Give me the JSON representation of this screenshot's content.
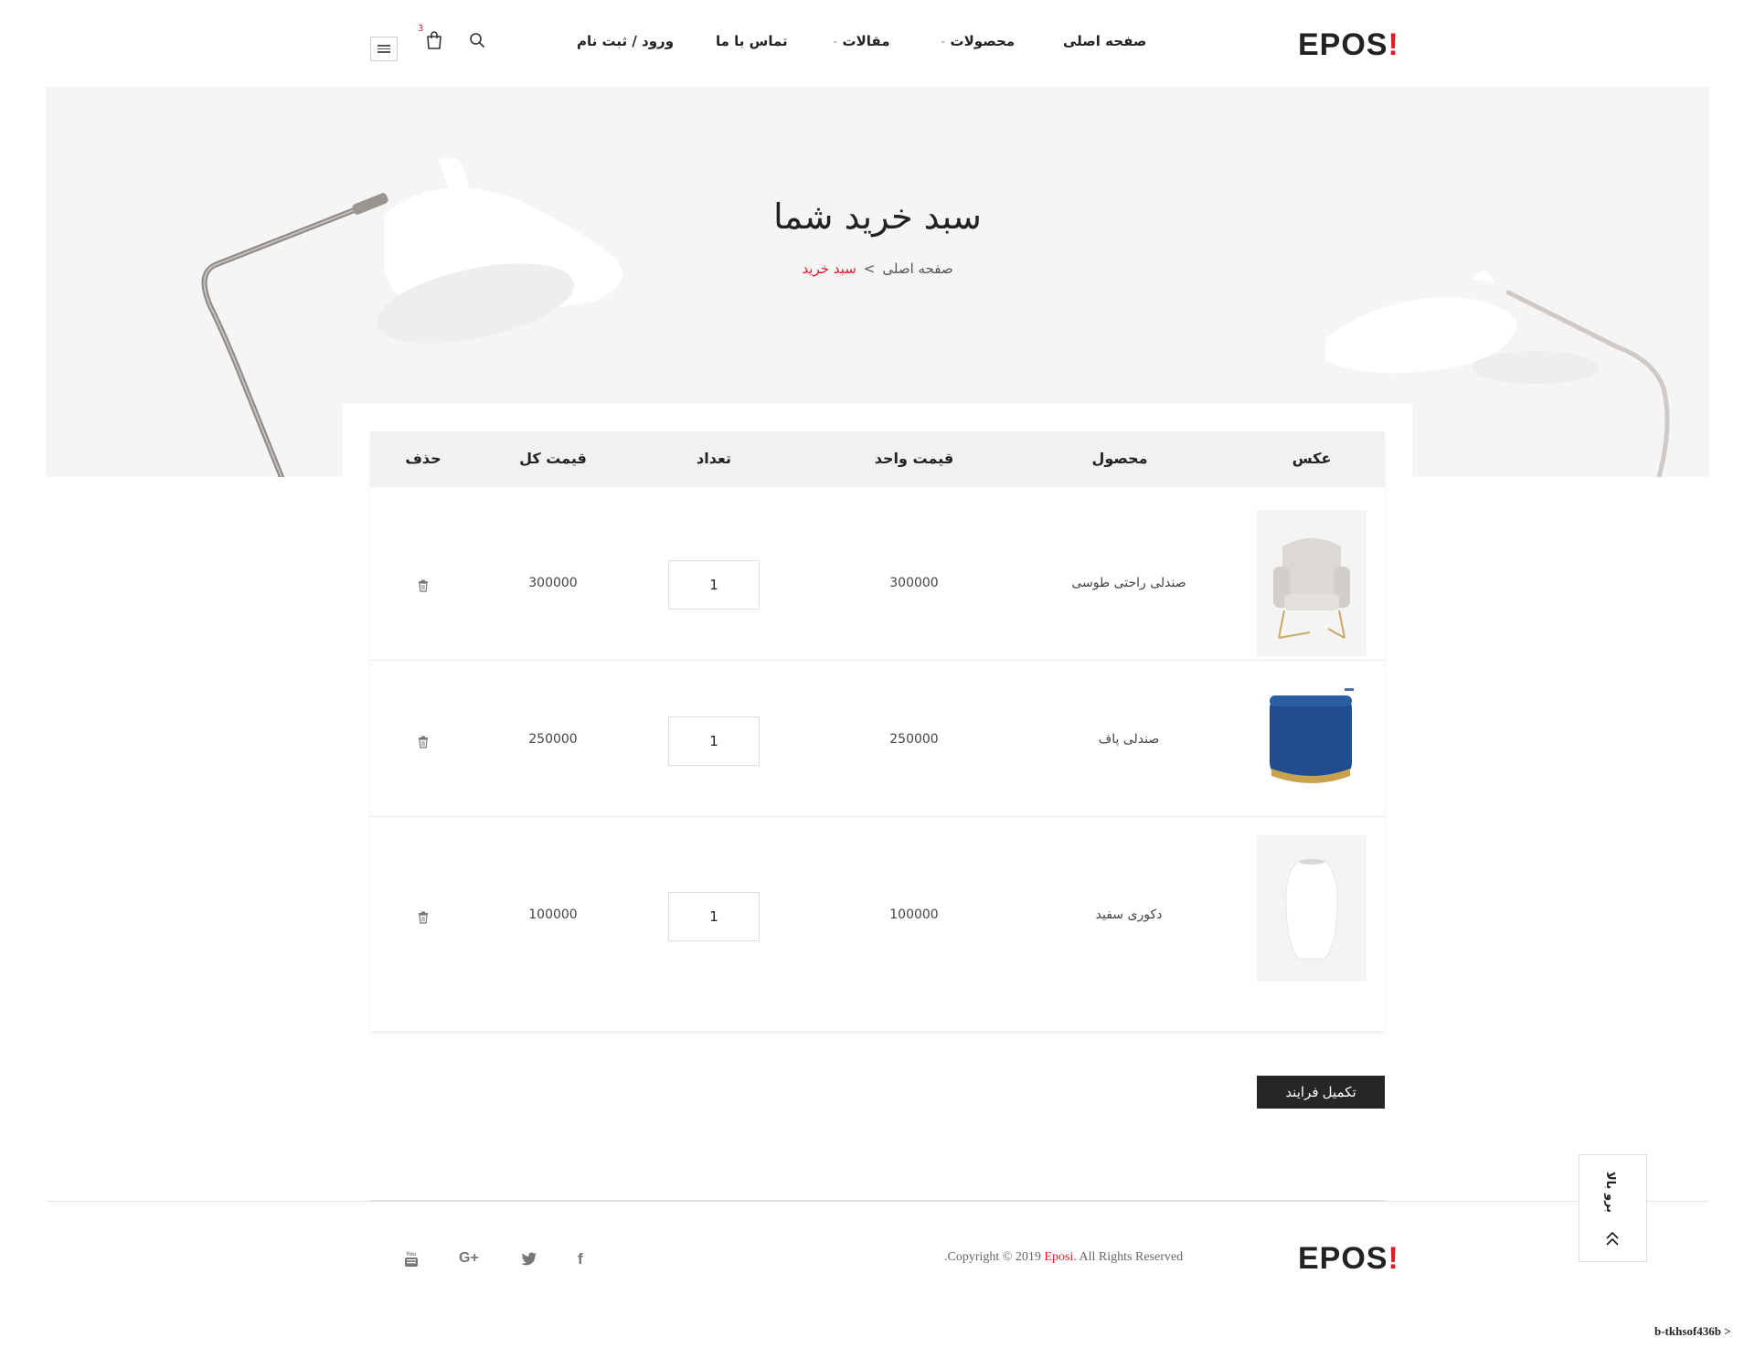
{
  "header": {
    "logo_text": "EPOS",
    "logo_mark": "!",
    "nav": {
      "home": "صفحه اصلی",
      "products": "محصولات",
      "articles": "مقالات",
      "contact": "تماس با ما",
      "login": "ورود / ثبت نام"
    },
    "cart_count": "3",
    "icons": [
      "search-icon",
      "cart-icon",
      "menu-icon",
      "chevron-down-icon"
    ]
  },
  "banner": {
    "title": "سبد خرید شما",
    "breadcrumb": {
      "home": "صفحه اصلی",
      "separator": ">",
      "current": "سبد خرید"
    }
  },
  "cart": {
    "headers": {
      "image": "عکس",
      "product": "محصول",
      "unit_price": "قیمت واحد",
      "quantity": "تعداد",
      "total": "قیمت کل",
      "remove": "حذف"
    },
    "items": [
      {
        "name": "صندلی راحتی طوسی",
        "unit_price": "300000",
        "quantity": "1",
        "total": "300000",
        "image": "armchair-image"
      },
      {
        "name": "صندلی پاف",
        "unit_price": "250000",
        "quantity": "1",
        "total": "250000",
        "image": "pouf-image"
      },
      {
        "name": "دکوری سفید",
        "unit_price": "100000",
        "quantity": "1",
        "total": "100000",
        "image": "vase-image"
      }
    ],
    "checkout_label": "تکمیل فرایند"
  },
  "footer": {
    "logo_text": "EPOS",
    "logo_mark": "!",
    "copyright_prefix": ".Copyright © 2019 ",
    "copyright_brand": "Eposi",
    "copyright_suffix": ". All Rights Reserved",
    "social": [
      "facebook-icon",
      "twitter-icon",
      "google-plus-icon",
      "youtube-icon"
    ],
    "back_to_top": "برو بالا"
  },
  "corner_text": "b-tkhsof436b >",
  "colors": {
    "accent": "#e01c2a",
    "dark_button": "#262626",
    "banner_bg": "#f5f5f5",
    "table_header_bg": "#f1f1f1"
  }
}
